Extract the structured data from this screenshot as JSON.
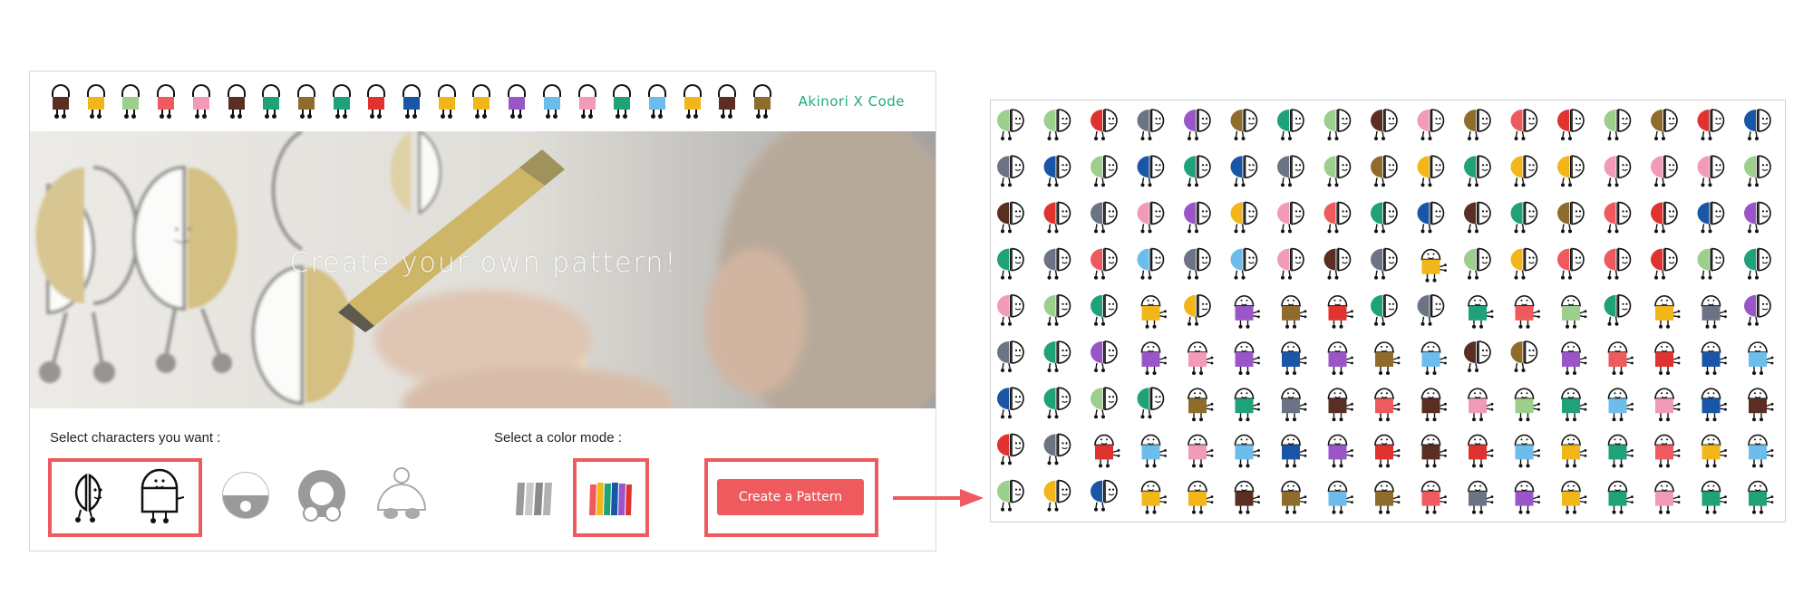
{
  "app": {
    "brand": "Akinori X Code",
    "hero_title": "Create your own pattern!",
    "select_characters_label": "Select characters you want :",
    "select_color_label": "Select a color mode :",
    "create_button_label": "Create a Pattern",
    "top_strip_colors": [
      "#5a2e22",
      "#f2b619",
      "#9ccf8c",
      "#ef5a5f",
      "#f29ab9",
      "#5a2e22",
      "#1fa27a",
      "#8f6c2c",
      "#1fa27a",
      "#e0322e",
      "#1a56a8",
      "#f2b619",
      "#f2b619",
      "#9a56c8",
      "#6cbcec",
      "#f29ab9",
      "#1fa27a",
      "#6cbcec",
      "#f2b619",
      "#5a2e22",
      "#8f6c2c"
    ],
    "characters": [
      {
        "name": "half-round-character-icon",
        "selected": true
      },
      {
        "name": "standing-character-icon",
        "selected": true
      },
      {
        "name": "bowl-character-icon",
        "selected": false
      },
      {
        "name": "donut-character-icon",
        "selected": false
      },
      {
        "name": "dome-character-icon",
        "selected": false
      }
    ],
    "color_modes": [
      {
        "name": "grayscale-mode-icon",
        "selected": false
      },
      {
        "name": "rainbow-mode-icon",
        "selected": true
      }
    ]
  },
  "accent_color": "#ef5a5f",
  "brand_color": "#20a97f",
  "pattern": {
    "palette": [
      "#9ccf8c",
      "#e0322e",
      "#6b7384",
      "#9a56c8",
      "#8f6c2c",
      "#1fa27a",
      "#5a2e22",
      "#f29ab9",
      "#ef5a5f",
      "#1a56a8",
      "#f2b619",
      "#6cbcec"
    ],
    "rows": [
      "h0 h0 h1 h2 h3 h4 h5 h0 h6 h7 h4 h8 h1 h0 h4 h1 h9",
      "h2 h9 h0 h9 h5 h9 h2 h0 h4 h10 h5 h10 h10 h7 h7 h7 h0",
      "h6 h1 h2 h7 h3 h10 h7 h8 h5 h9 h6 h5 h4 h8 h1 h9 h3",
      "h5 h2 h8 h11 h2 h11 h7 h6 h2 s10 h0 h10 h8 h8 h1 h0 h5",
      "h7 h0 h5 s10 h10 s3 s4 s1 h5 h2 s5 s8 s0 h5 s10 s2 h3",
      "h2 h5 h3 s3 s7 s3 s9 s3 s4 s11 h6 h4 s3 s8 s1 s9 s11",
      "h9 h5 h0 h5 s4 s5 s2 s6 s8 s6 s7 s0 s5 s11 s7 s9 s6",
      "h1 h2 s1 s11 s7 s11 s9 s3 s1 s6 s1 s11 s10 s5 s8 s10 s11",
      "h0 h10 h9 s10 s10 s6 s4 s11 s4 s8 s2 s3 s10 s5 s7 s5 s5"
    ]
  }
}
